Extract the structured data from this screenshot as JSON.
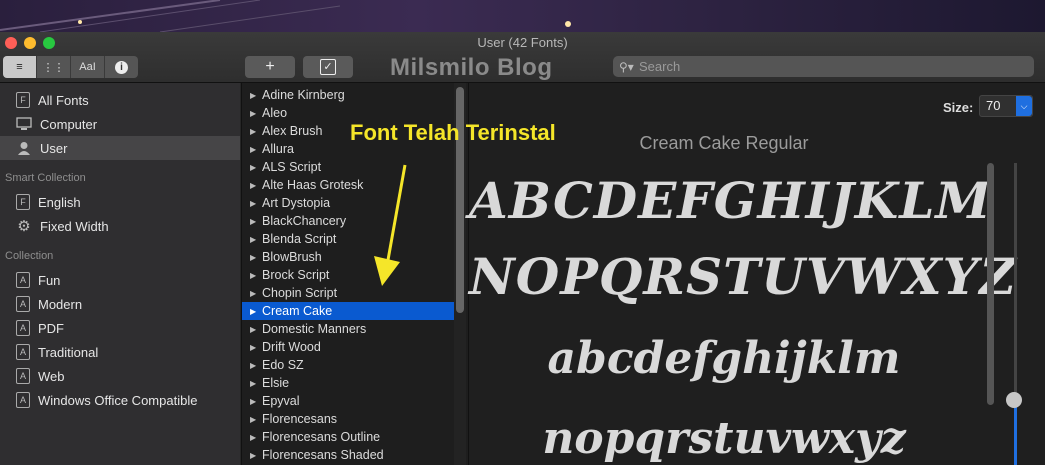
{
  "window": {
    "title": "User (42 Fonts)"
  },
  "toolbar": {
    "view_buttons": [
      "≡",
      "⋮⋮",
      "AaI",
      "i"
    ],
    "add_label": "+",
    "check_label": "✓",
    "search_placeholder": "Search"
  },
  "watermark": "Milsmilo Blog",
  "annotation": "Font Telah Terinstal",
  "sidebar": {
    "items": [
      {
        "label": "All Fonts",
        "icon": "font-box-icon"
      },
      {
        "label": "Computer",
        "icon": "monitor-icon"
      },
      {
        "label": "User",
        "icon": "user-icon",
        "selected": true
      }
    ],
    "smart_collection_heading": "Smart Collection",
    "smart_items": [
      {
        "label": "English",
        "icon": "font-box-icon"
      },
      {
        "label": "Fixed Width",
        "icon": "gear-icon"
      }
    ],
    "collection_heading": "Collection",
    "collection_items": [
      {
        "label": "Fun"
      },
      {
        "label": "Modern"
      },
      {
        "label": "PDF"
      },
      {
        "label": "Traditional"
      },
      {
        "label": "Web"
      },
      {
        "label": "Windows Office Compatible"
      }
    ]
  },
  "font_list": [
    "Adine Kirnberg",
    "Aleo",
    "Alex Brush",
    "Allura",
    "ALS Script",
    "Alte Haas Grotesk",
    "Art Dystopia",
    "BlackChancery",
    "Blenda Script",
    "BlowBrush",
    "Brock Script",
    "Chopin Script",
    "Cream Cake",
    "Domestic Manners",
    "Drift Wood",
    "Edo SZ",
    "Elsie",
    "Epyval",
    "Florencesans",
    "Florencesans Outline",
    "Florencesans Shaded"
  ],
  "selected_font": "Cream Cake",
  "preview": {
    "size_label": "Size:",
    "size_value": "70",
    "font_name": "Cream Cake Regular",
    "line1": "ABCDEFGHIJKLM",
    "line2": "NOPQRSTUVWXYZ",
    "line3": "abcdefghijklm",
    "line4": "nopqrstuvwxyz"
  },
  "colors": {
    "selection": "#0a5ad0",
    "annotation": "#f5e629"
  }
}
